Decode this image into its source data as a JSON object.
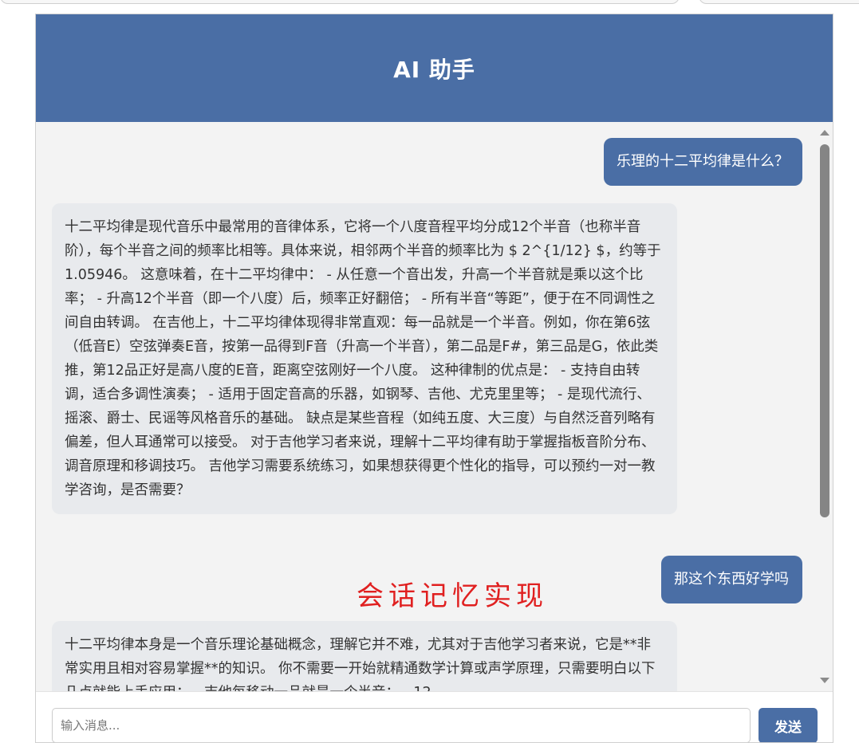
{
  "header": {
    "title": "AI 助手"
  },
  "overlay": {
    "caption": "会话记忆实现"
  },
  "messages": [
    {
      "role": "user",
      "text": "乐理的十二平均律是什么？"
    },
    {
      "role": "assistant",
      "text": "十二平均律是现代音乐中最常用的音律体系，它将一个八度音程平均分成12个半音（也称半音阶），每个半音之间的频率比相等。具体来说，相邻两个半音的频率比为 $ 2^{1/12} $，约等于1.05946。 这意味着，在十二平均律中： - 从任意一个音出发，升高一个半音就是乘以这个比率； - 升高12个半音（即一个八度）后，频率正好翻倍； - 所有半音“等距”，便于在不同调性之间自由转调。 在吉他上，十二平均律体现得非常直观：每一品就是一个半音。例如，你在第6弦（低音E）空弦弹奏E音，按第一品得到F音（升高一个半音），第二品是F#，第三品是G，依此类推，第12品正好是高八度的E音，距离空弦刚好一个八度。 这种律制的优点是： - 支持自由转调，适合多调性演奏； - 适用于固定音高的乐器，如钢琴、吉他、尤克里里等； - 是现代流行、摇滚、爵士、民谣等风格音乐的基础。 缺点是某些音程（如纯五度、大三度）与自然泛音列略有偏差，但人耳通常可以接受。 对于吉他学习者来说，理解十二平均律有助于掌握指板音阶分布、调音原理和移调技巧。 吉他学习需要系统练习，如果想获得更个性化的指导，可以预约一对一教学咨询，是否需要？"
    },
    {
      "role": "user",
      "text": "那这个东西好学吗"
    },
    {
      "role": "assistant",
      "text": "十二平均律本身是一个音乐理论基础概念，理解它并不难，尤其对于吉他学习者来说，它是**非常实用且相对容易掌握**的知识。 你不需要一开始就精通数学计算或声学原理，只需要明白以下几点就能上手应用： - 吉他每移动一品就是一个半音； - 12"
    }
  ],
  "input": {
    "placeholder": "输入消息..."
  },
  "send_button": {
    "label": "发送"
  },
  "colors": {
    "accent": "#4a6ea5",
    "overlay_text": "#e02020",
    "bot_bubble": "#e8eaed",
    "chat_bg": "#f3f3f3"
  }
}
